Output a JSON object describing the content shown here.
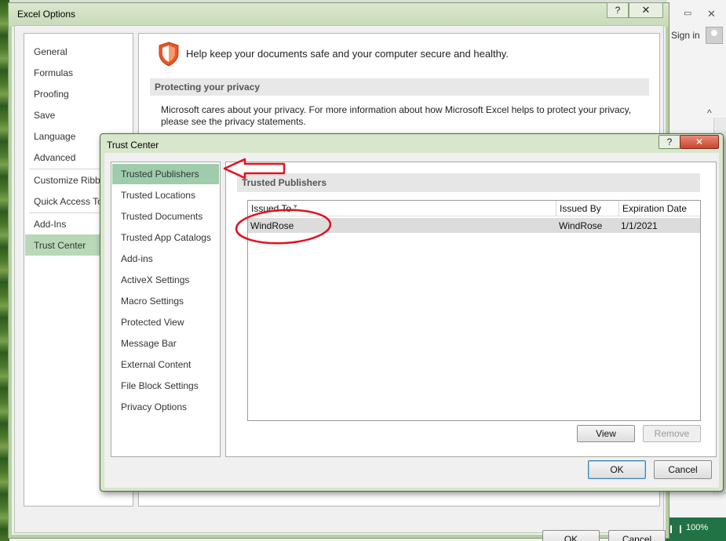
{
  "background": {
    "sign_in": "Sign in",
    "zoom_percent": "100%"
  },
  "excel_options": {
    "title": "Excel Options",
    "help_label": "?",
    "close_label": "✕",
    "nav": [
      "General",
      "Formulas",
      "Proofing",
      "Save",
      "Language",
      "Advanced",
      "Customize Ribbon",
      "Quick Access Toolbar",
      "Add-Ins",
      "Trust Center"
    ],
    "selected_nav": "Trust Center",
    "tagline": "Help keep your documents safe and your computer secure and healthy.",
    "section_title": "Protecting your privacy",
    "privacy_text": "Microsoft cares about your privacy. For more information about how Microsoft Excel helps to protect your privacy, please see the privacy statements.",
    "ok_label": "OK",
    "cancel_label": "Cancel"
  },
  "trust_center": {
    "title": "Trust Center",
    "help_label": "?",
    "close_label": "✕",
    "nav": [
      "Trusted Publishers",
      "Trusted Locations",
      "Trusted Documents",
      "Trusted App Catalogs",
      "Add-ins",
      "ActiveX Settings",
      "Macro Settings",
      "Protected View",
      "Message Bar",
      "External Content",
      "File Block Settings",
      "Privacy Options"
    ],
    "selected_nav": "Trusted Publishers",
    "section_title": "Trusted Publishers",
    "columns": [
      "Issued To",
      "Issued By",
      "Expiration Date"
    ],
    "rows": [
      {
        "issued_to": "WindRose",
        "issued_by": "WindRose",
        "expiration": "1/1/2021"
      }
    ],
    "view_label": "View",
    "remove_label": "Remove",
    "ok_label": "OK",
    "cancel_label": "Cancel"
  },
  "colors": {
    "annotation_red": "#e0141e",
    "selection_green": "#9fccab",
    "shield_orange": "#e8572a"
  }
}
